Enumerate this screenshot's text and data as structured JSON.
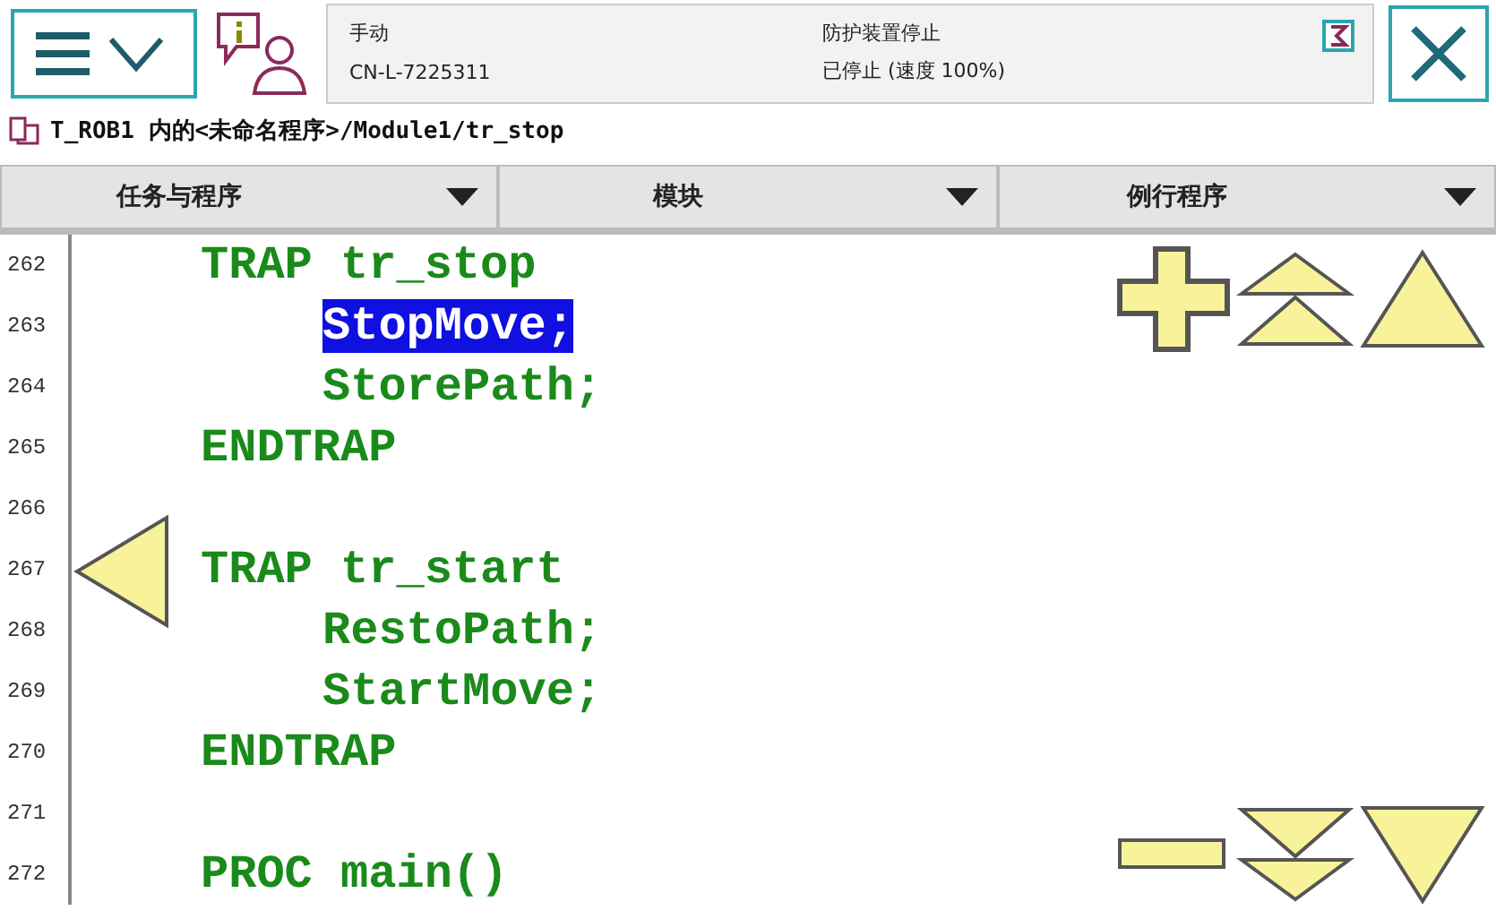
{
  "status": {
    "mode": "手动",
    "system": "CN-L-7225311",
    "state": "防护装置停止",
    "speed": "已停止 (速度 100%)"
  },
  "path": "T_ROB1 内的<未命名程序>/Module1/tr_stop",
  "tabs": [
    {
      "label": "任务与程序"
    },
    {
      "label": "模块"
    },
    {
      "label": "例行程序"
    }
  ],
  "lines": [
    {
      "number": "262",
      "kind": "block",
      "code": "TRAP tr_stop",
      "selected": false
    },
    {
      "number": "263",
      "kind": "statement",
      "code": "StopMove;",
      "selected": true
    },
    {
      "number": "264",
      "kind": "statement",
      "code": "StorePath;",
      "selected": false
    },
    {
      "number": "265",
      "kind": "block",
      "code": "ENDTRAP",
      "selected": false
    },
    {
      "number": "266"
    },
    {
      "number": "267",
      "kind": "block",
      "code": "TRAP tr_start",
      "selected": false
    },
    {
      "number": "268",
      "kind": "statement",
      "code": "RestoPath;",
      "selected": false
    },
    {
      "number": "269",
      "kind": "statement",
      "code": "StartMove;",
      "selected": false
    },
    {
      "number": "270",
      "kind": "block",
      "code": "ENDTRAP",
      "selected": false
    },
    {
      "number": "271"
    },
    {
      "number": "272",
      "kind": "block",
      "code": "PROC main()",
      "selected": false
    }
  ]
}
